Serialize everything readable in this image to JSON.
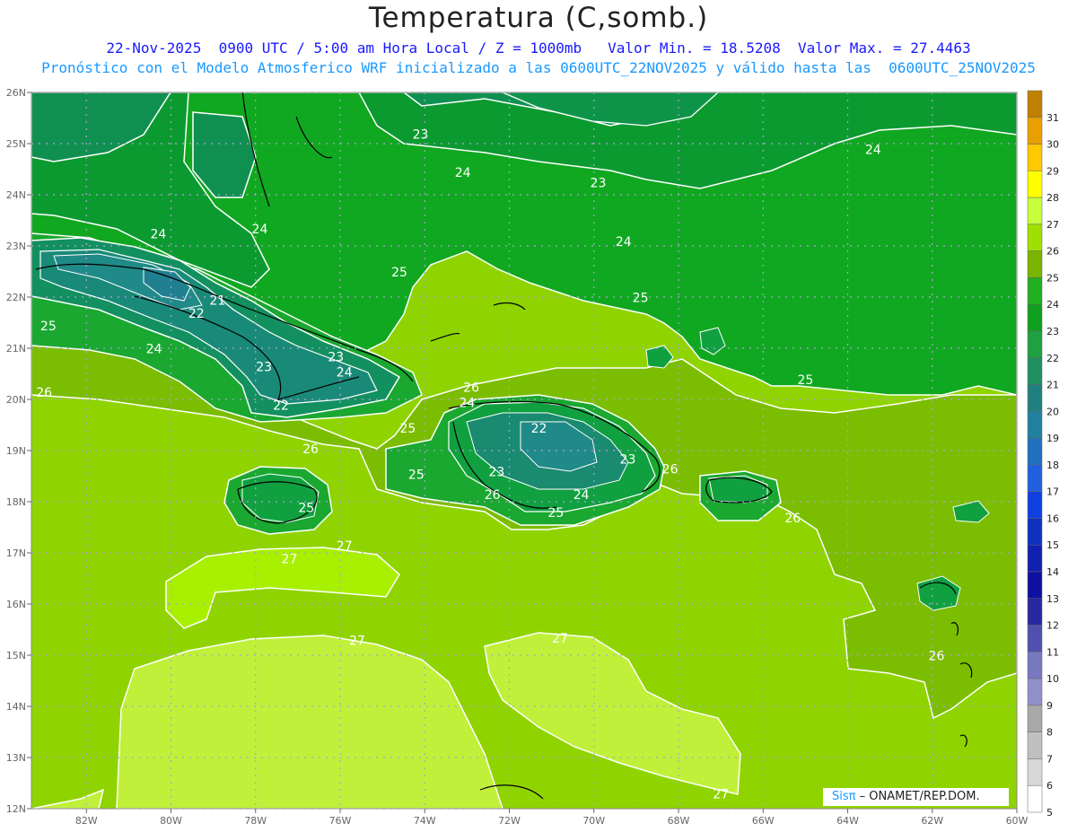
{
  "title": "Temperatura (C,somb.)",
  "subtitle_line1": "22-Nov-2025  0900 UTC / 5:00 am Hora Local / Z = 1000mb   Valor Min. = 18.5208  Valor Max. = 27.4463",
  "subtitle_line2": "Pronóstico con el Modelo Atmosferico WRF inicializado a las 0600UTC_22NOV2025 y válido hasta las  0600UTC_25NOV2025",
  "credit_brand": "Sisπ",
  "credit_text": " – ONAMET/REP.DOM.",
  "lat_labels": [
    "26N",
    "25N",
    "24N",
    "23N",
    "22N",
    "21N",
    "20N",
    "19N",
    "18N",
    "17N",
    "16N",
    "15N",
    "14N",
    "13N",
    "12N"
  ],
  "lon_labels": [
    "82W",
    "80W",
    "78W",
    "76W",
    "74W",
    "72W",
    "70W",
    "68W",
    "66W",
    "64W",
    "62W",
    "60W"
  ],
  "colorbar": {
    "levels": [
      "31",
      "30",
      "29",
      "28",
      "27",
      "26",
      "25",
      "24",
      "23",
      "22",
      "21",
      "20",
      "19",
      "18",
      "17",
      "16",
      "15",
      "14",
      "13",
      "12",
      "11",
      "10",
      "9",
      "8",
      "7",
      "6",
      "5"
    ],
    "colors": [
      "#c08000",
      "#e8a000",
      "#ffc800",
      "#ffff00",
      "#c8ff3c",
      "#a0e000",
      "#78b400",
      "#20b020",
      "#10a020",
      "#20a040",
      "#209060",
      "#208080",
      "#2080a0",
      "#2070c0",
      "#2060e0",
      "#1040e0",
      "#1030c0",
      "#1020b0",
      "#1010a0",
      "#2828a0",
      "#5050b0",
      "#7878c0",
      "#9090c8",
      "#a8a8a8",
      "#c0c0c0",
      "#d8d8d8",
      "#ffffff"
    ]
  },
  "contour_labels": [
    {
      "text": "23",
      "lon": -74.1,
      "lat": 25.1
    },
    {
      "text": "24",
      "lon": -63.4,
      "lat": 24.8
    },
    {
      "text": "24",
      "lon": -73.1,
      "lat": 24.35
    },
    {
      "text": "23",
      "lon": -69.9,
      "lat": 24.15
    },
    {
      "text": "24",
      "lon": -80.3,
      "lat": 23.15
    },
    {
      "text": "24",
      "lon": -77.9,
      "lat": 23.25
    },
    {
      "text": "24",
      "lon": -69.3,
      "lat": 23.0
    },
    {
      "text": "25",
      "lon": -74.6,
      "lat": 22.4
    },
    {
      "text": "25",
      "lon": -68.9,
      "lat": 21.9
    },
    {
      "text": "21",
      "lon": -78.9,
      "lat": 21.85
    },
    {
      "text": "22",
      "lon": -79.4,
      "lat": 21.6
    },
    {
      "text": "25",
      "lon": -82.9,
      "lat": 21.35
    },
    {
      "text": "24",
      "lon": -80.4,
      "lat": 20.9
    },
    {
      "text": "23",
      "lon": -76.1,
      "lat": 20.75
    },
    {
      "text": "23",
      "lon": -77.8,
      "lat": 20.55
    },
    {
      "text": "24",
      "lon": -75.9,
      "lat": 20.45
    },
    {
      "text": "25",
      "lon": -65.0,
      "lat": 20.3
    },
    {
      "text": "26",
      "lon": -83.0,
      "lat": 20.05
    },
    {
      "text": "26",
      "lon": -72.9,
      "lat": 20.15
    },
    {
      "text": "24",
      "lon": -73.0,
      "lat": 19.85
    },
    {
      "text": "22",
      "lon": -77.4,
      "lat": 19.8
    },
    {
      "text": "25",
      "lon": -74.4,
      "lat": 19.35
    },
    {
      "text": "22",
      "lon": -71.3,
      "lat": 19.35
    },
    {
      "text": "26",
      "lon": -76.7,
      "lat": 18.95
    },
    {
      "text": "23",
      "lon": -69.2,
      "lat": 18.75
    },
    {
      "text": "25",
      "lon": -74.2,
      "lat": 18.45
    },
    {
      "text": "23",
      "lon": -72.3,
      "lat": 18.5
    },
    {
      "text": "26",
      "lon": -68.2,
      "lat": 18.55
    },
    {
      "text": "26",
      "lon": -72.4,
      "lat": 18.05
    },
    {
      "text": "24",
      "lon": -70.3,
      "lat": 18.05
    },
    {
      "text": "25",
      "lon": -76.8,
      "lat": 17.8
    },
    {
      "text": "25",
      "lon": -70.9,
      "lat": 17.7
    },
    {
      "text": "26",
      "lon": -65.3,
      "lat": 17.6
    },
    {
      "text": "27",
      "lon": -77.2,
      "lat": 16.8
    },
    {
      "text": "27",
      "lon": -75.9,
      "lat": 17.05
    },
    {
      "text": "27",
      "lon": -75.6,
      "lat": 15.2
    },
    {
      "text": "27",
      "lon": -70.8,
      "lat": 15.25
    },
    {
      "text": "26",
      "lon": -61.9,
      "lat": 14.9
    },
    {
      "text": "27",
      "lon": -67.0,
      "lat": 12.2
    }
  ]
}
